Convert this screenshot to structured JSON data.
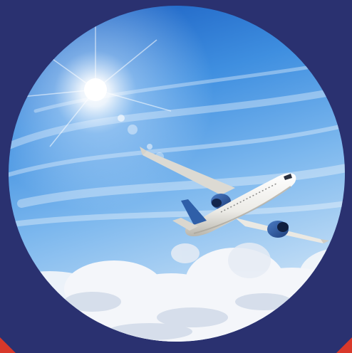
{
  "image": {
    "subject": "airplane-in-sky",
    "shape": "circle"
  },
  "colors": {
    "background": "#2a3170",
    "accent": "#d8382a",
    "sky_top": "#1565c8",
    "sky_mid": "#5aa4e8",
    "sky_bottom": "#b9d8f4",
    "cloud": "#f4f6fa",
    "plane_body": "#f2f2f0",
    "engine": "#2f5fa8"
  }
}
